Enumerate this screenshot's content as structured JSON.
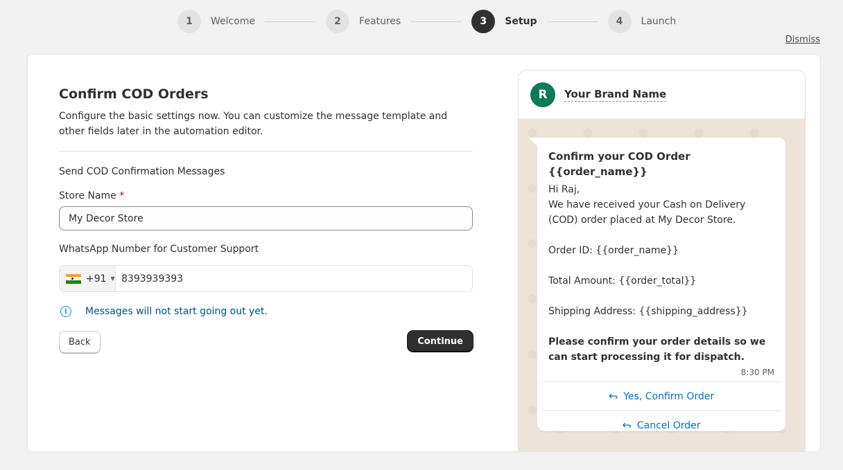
{
  "stepper": {
    "steps": [
      {
        "number": "1",
        "label": "Welcome"
      },
      {
        "number": "2",
        "label": "Features"
      },
      {
        "number": "3",
        "label": "Setup"
      },
      {
        "number": "4",
        "label": "Launch"
      }
    ]
  },
  "dismiss_label": "Dismiss",
  "form": {
    "title": "Confirm COD Orders",
    "subtitle": "Configure the basic settings now. You can customize the message template and other fields later in the automation editor.",
    "section_label": "Send COD Confirmation Messages",
    "store_name_label": "Store Name",
    "required_marker": "*",
    "store_name_value": "My Decor Store",
    "whatsapp_label": "WhatsApp Number for Customer Support",
    "country_code": "+91",
    "phone_value": "8393939393",
    "info_text": "Messages will not start going out yet.",
    "back_label": "Back",
    "continue_label": "Continue"
  },
  "preview": {
    "avatar_letter": "R",
    "brand_name": "Your Brand Name",
    "message_title": "Confirm your COD Order {{order_name}}",
    "greeting": "Hi Raj,",
    "body_line1": "We have received your Cash on Delivery (COD) order placed at My Decor Store.",
    "order_id_line": "Order ID: {{order_name}}",
    "total_line": "Total Amount: {{order_total}}",
    "shipping_line": "Shipping Address: {{shipping_address}}",
    "closing": "Please confirm your order details so we can start processing it for dispatch.",
    "time": "8:30 PM",
    "reply_yes": "Yes, Confirm Order",
    "reply_cancel": "Cancel Order"
  }
}
